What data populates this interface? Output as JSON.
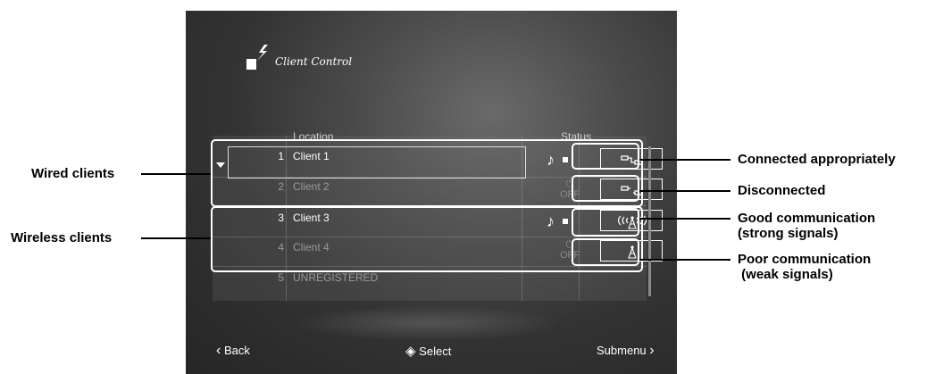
{
  "screen": {
    "title": "Client Control",
    "columns": {
      "location": "Location",
      "status": "Status"
    },
    "rows": [
      {
        "number": "1",
        "name": "Client 1",
        "playing_icon": "music-note-icon",
        "power": ""
      },
      {
        "number": "2",
        "name": "Client 2",
        "playing_icon": "",
        "power": "OFF"
      },
      {
        "number": "3",
        "name": "Client 3",
        "playing_icon": "music-note-icon",
        "power": ""
      },
      {
        "number": "4",
        "name": "Client 4",
        "playing_icon": "",
        "power": "OFF"
      },
      {
        "number": "5",
        "name": "UNREGISTERED",
        "playing_icon": "",
        "power": ""
      }
    ],
    "status_icons": [
      "wired-connected-icon",
      "wired-disconnected-icon",
      "wireless-strong-signal-icon",
      "wireless-weak-signal-icon"
    ],
    "footer": {
      "back": "Back",
      "select": "Select",
      "submenu": "Submenu"
    }
  },
  "glyphs": {
    "power": "⏻",
    "note": "♪",
    "back_chevron": "‹",
    "submenu_chevron": "›",
    "select_icon": "◈"
  },
  "annotations": {
    "wired_clients": "Wired clients",
    "wireless_clients": "Wireless clients",
    "connected": "Connected appropriately",
    "disconnected": "Disconnected",
    "good_comm_line1": "Good communication",
    "good_comm_line2": "(strong signals)",
    "poor_comm_line1": "Poor communication",
    "poor_comm_line2": " (weak signals)"
  },
  "colors": {
    "screen_bg": "#3a3a3a",
    "text": "#ffffff",
    "dim_text": "#9a9a9a",
    "callout": "#000000"
  }
}
